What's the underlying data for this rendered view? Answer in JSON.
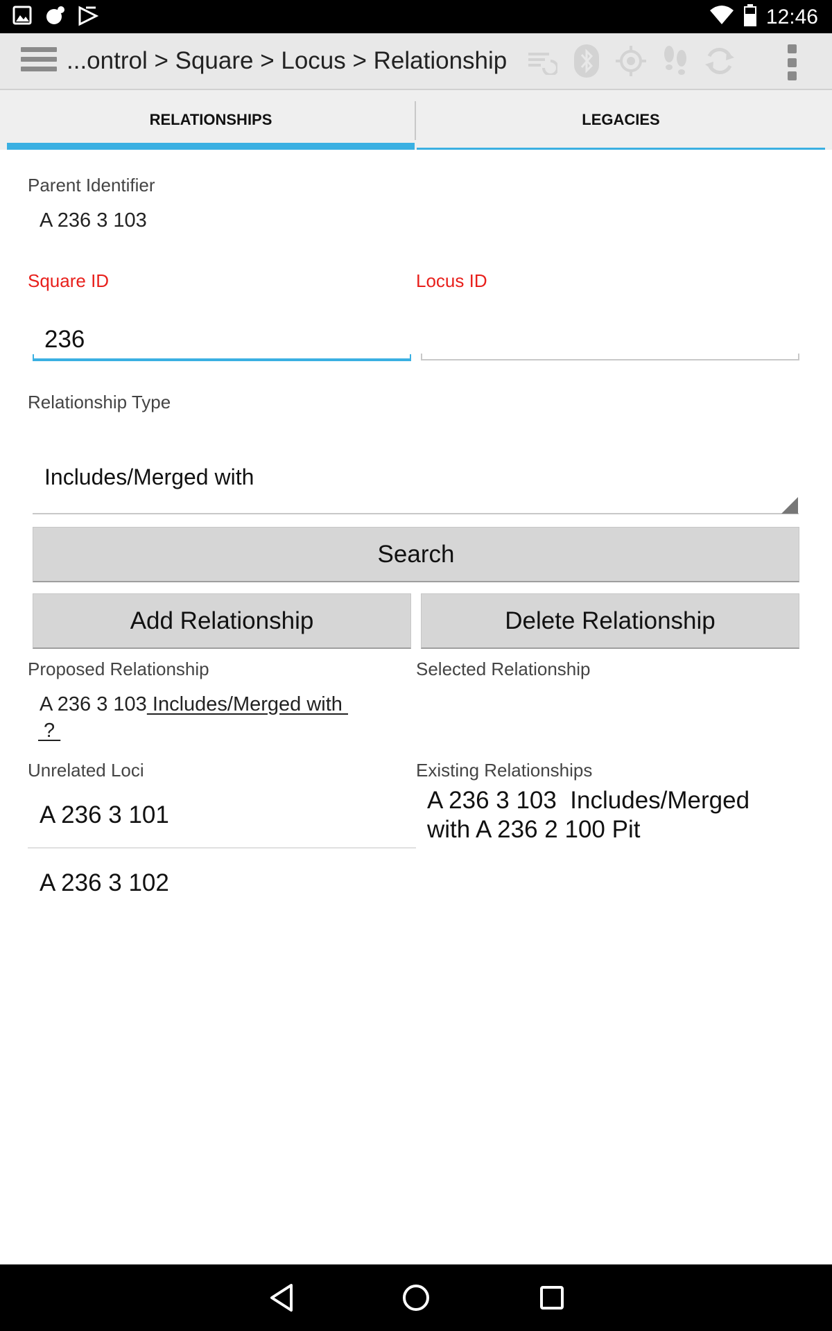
{
  "status_bar": {
    "time": "12:46",
    "left_icons": [
      "image-icon",
      "weather-icon",
      "play-store-icon"
    ],
    "right_icons": [
      "wifi-icon",
      "battery-icon"
    ]
  },
  "action_bar": {
    "breadcrumb": "...ontrol > Square > Locus > Relationship",
    "icons": [
      "sync-icon",
      "bluetooth-icon",
      "gps-icon",
      "footprints-icon",
      "refresh-icon"
    ]
  },
  "tabs": [
    {
      "label": "RELATIONSHIPS",
      "selected": true
    },
    {
      "label": "LEGACIES",
      "selected": false
    }
  ],
  "form": {
    "parent_identifier_label": "Parent Identifier",
    "parent_identifier_value": "A 236 3 103",
    "square_id_label": "Square ID",
    "square_id_value": "236",
    "locus_id_label": "Locus ID",
    "locus_id_value": "",
    "relationship_type_label": "Relationship Type",
    "relationship_type_value": "Includes/Merged with"
  },
  "buttons": {
    "search": "Search",
    "add": "Add Relationship",
    "delete": "Delete Relationship"
  },
  "proposed": {
    "label": "Proposed Relationship",
    "prefix": "A 236 3 103",
    "link_text": " Includes/Merged with ",
    "second_line": " ? "
  },
  "selected": {
    "label": "Selected Relationship"
  },
  "unrelated": {
    "label": "Unrelated Loci",
    "items": [
      "A 236 3 101",
      "A 236 3 102"
    ]
  },
  "existing": {
    "label": "Existing Relationships",
    "items": [
      "A 236 3 103  Includes/Merged with A 236 2 100 Pit"
    ]
  },
  "colors": {
    "accent": "#3ab0e2",
    "required_label": "#e8201c",
    "button_bg": "#d6d6d6"
  }
}
